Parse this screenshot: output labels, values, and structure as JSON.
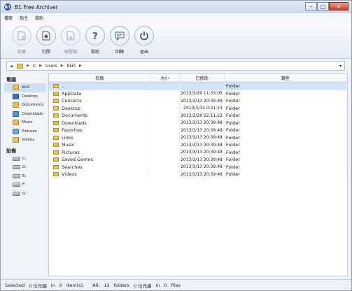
{
  "window": {
    "title": "B1 Free Archiver",
    "app_icon_text": "B1"
  },
  "menu": [
    "檔案",
    "指令",
    "幫助"
  ],
  "toolbar": [
    {
      "label": "創建",
      "icon": "create-archive-icon",
      "enabled": false
    },
    {
      "label": "打開",
      "icon": "open-archive-icon",
      "enabled": true
    },
    {
      "label": "解壓縮",
      "icon": "extract-icon",
      "enabled": false
    },
    {
      "label": "幫助",
      "icon": "help-icon",
      "enabled": true
    },
    {
      "label": "回饋",
      "icon": "feedback-icon",
      "enabled": true
    },
    {
      "label": "退出",
      "icon": "power-icon",
      "enabled": true
    }
  ],
  "address": {
    "parts": [
      "C",
      "Users",
      "bkill"
    ]
  },
  "sidebar": {
    "computer_heading": "電腦",
    "places": [
      {
        "label": "bkill",
        "icon": "user-folder-icon",
        "selected": true
      },
      {
        "label": "Desktop",
        "icon": "desktop-icon"
      },
      {
        "label": "Documents",
        "icon": "documents-icon"
      },
      {
        "label": "Downloads",
        "icon": "downloads-icon"
      },
      {
        "label": "Music",
        "icon": "music-icon"
      },
      {
        "label": "Pictures",
        "icon": "pictures-icon"
      },
      {
        "label": "Videos",
        "icon": "videos-icon"
      }
    ],
    "devices_heading": "設備",
    "drives": [
      "C:",
      "D:",
      "E:",
      "F:",
      "G:"
    ]
  },
  "columns": {
    "name": "名稱",
    "size": "大小",
    "modified": "已修改",
    "type": "類型"
  },
  "files": [
    {
      "name": "..",
      "size": "",
      "modified": "",
      "type": "Folder"
    },
    {
      "name": "AppData",
      "size": "",
      "modified": "2013/3/29 11:33:05",
      "type": "Folder"
    },
    {
      "name": "Contacts",
      "size": "",
      "modified": "2013/3/13 20:39:48",
      "type": "Folder"
    },
    {
      "name": "Desktop",
      "size": "",
      "modified": "2013/3/31 0:31:13",
      "type": "Folder"
    },
    {
      "name": "Documents",
      "size": "",
      "modified": "2013/3/28 22:11:22",
      "type": "Folder"
    },
    {
      "name": "Downloads",
      "size": "",
      "modified": "2013/3/13 20:39:48",
      "type": "Folder"
    },
    {
      "name": "Favorites",
      "size": "",
      "modified": "2013/3/13 20:39:48",
      "type": "Folder"
    },
    {
      "name": "Links",
      "size": "",
      "modified": "2013/3/13 20:39:48",
      "type": "Folder"
    },
    {
      "name": "Music",
      "size": "",
      "modified": "2013/3/13 20:39:48",
      "type": "Folder"
    },
    {
      "name": "Pictures",
      "size": "",
      "modified": "2013/3/13 20:39:48",
      "type": "Folder"
    },
    {
      "name": "Saved Games",
      "size": "",
      "modified": "2013/3/13 20:39:48",
      "type": "Folder"
    },
    {
      "name": "Searches",
      "size": "",
      "modified": "2013/3/13 20:39:48",
      "type": "Folder"
    },
    {
      "name": "Videos",
      "size": "",
      "modified": "2013/3/13 20:39:48",
      "type": "Folder"
    }
  ],
  "status": {
    "selected_label": "Selected",
    "selected_size": "0 位元組",
    "in": "in",
    "selected_count": "0",
    "items_label": "item(s).",
    "all_label": "All:",
    "all_count": "12",
    "folders_label": "folders",
    "all_size": "0 位元組",
    "files_count": "0",
    "files_label": "files"
  }
}
